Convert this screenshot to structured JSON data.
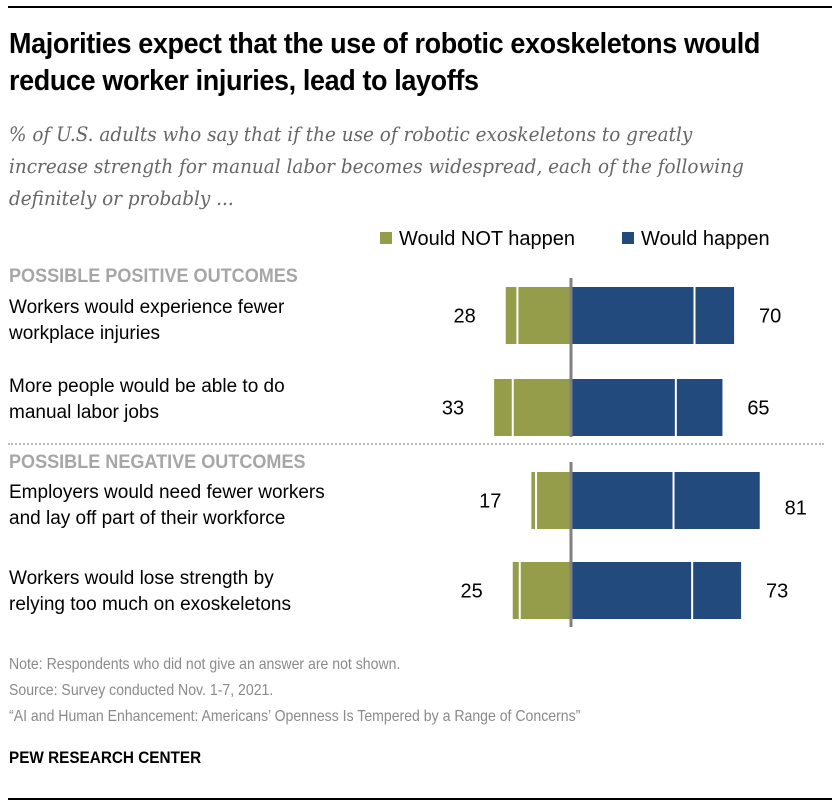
{
  "header": {
    "title": "Majorities expect that the use of robotic exoskeletons would reduce worker injuries, lead to layoffs",
    "subtitle": "% of U.S. adults who say that if the use of robotic exoskeletons to greatly increase strength for manual labor becomes widespread, each of the following definitely or probably ..."
  },
  "colors": {
    "not_happen": "#959d4a",
    "happen": "#234a7c",
    "center_line": "#808080",
    "section_label": "#a6a6a6"
  },
  "chart_data": {
    "type": "bar",
    "orientation": "horizontal-diverging",
    "title": "Majorities expect that the use of robotic exoskeletons would reduce worker injuries, lead to layoffs",
    "legend": [
      "Would NOT happen",
      "Would happen"
    ],
    "legend_position": "top-right",
    "sections": [
      {
        "label": "POSSIBLE POSITIVE OUTCOMES",
        "rows": [
          0,
          1
        ]
      },
      {
        "label": "POSSIBLE NEGATIVE OUTCOMES",
        "rows": [
          2,
          3
        ]
      }
    ],
    "categories": [
      "Workers would experience fewer workplace injuries",
      "More people would be able to do manual labor jobs",
      "Employers would need fewer workers and lay off part of their workforce",
      "Workers would lose strength by relying too much on exoskeletons"
    ],
    "series": [
      {
        "name": "Would NOT happen",
        "values": [
          28,
          33,
          17,
          25
        ],
        "segments": {
          "probably": [
            23,
            25,
            15,
            22
          ],
          "definitely": [
            5,
            8,
            2,
            3
          ]
        }
      },
      {
        "name": "Would happen",
        "values": [
          70,
          65,
          81,
          73
        ],
        "segments": {
          "probably": [
            53,
            45,
            44,
            52
          ],
          "definitely": [
            17,
            20,
            37,
            21
          ]
        }
      }
    ],
    "value_labels": [
      "28",
      "70",
      "33",
      "65",
      "17",
      "81",
      "25",
      "73"
    ]
  },
  "labels": {
    "row0_line1": "Workers would experience fewer",
    "row0_line2": "workplace injuries",
    "row1_line1": "More people would be able to do",
    "row1_line2": "manual labor jobs",
    "row2_line1": "Employers would need fewer workers",
    "row2_line2": "and lay off part of their workforce",
    "row3_line1": "Workers would lose strength by",
    "row3_line2": "relying too much on exoskeletons"
  },
  "footer": {
    "note": "Note: Respondents who did not give an answer are not shown.",
    "source": "Source: Survey conducted Nov. 1-7, 2021.",
    "report": "“AI and Human Enhancement: Americans’ Openness Is Tempered by a Range of Concerns”",
    "brand": "PEW RESEARCH CENTER"
  }
}
